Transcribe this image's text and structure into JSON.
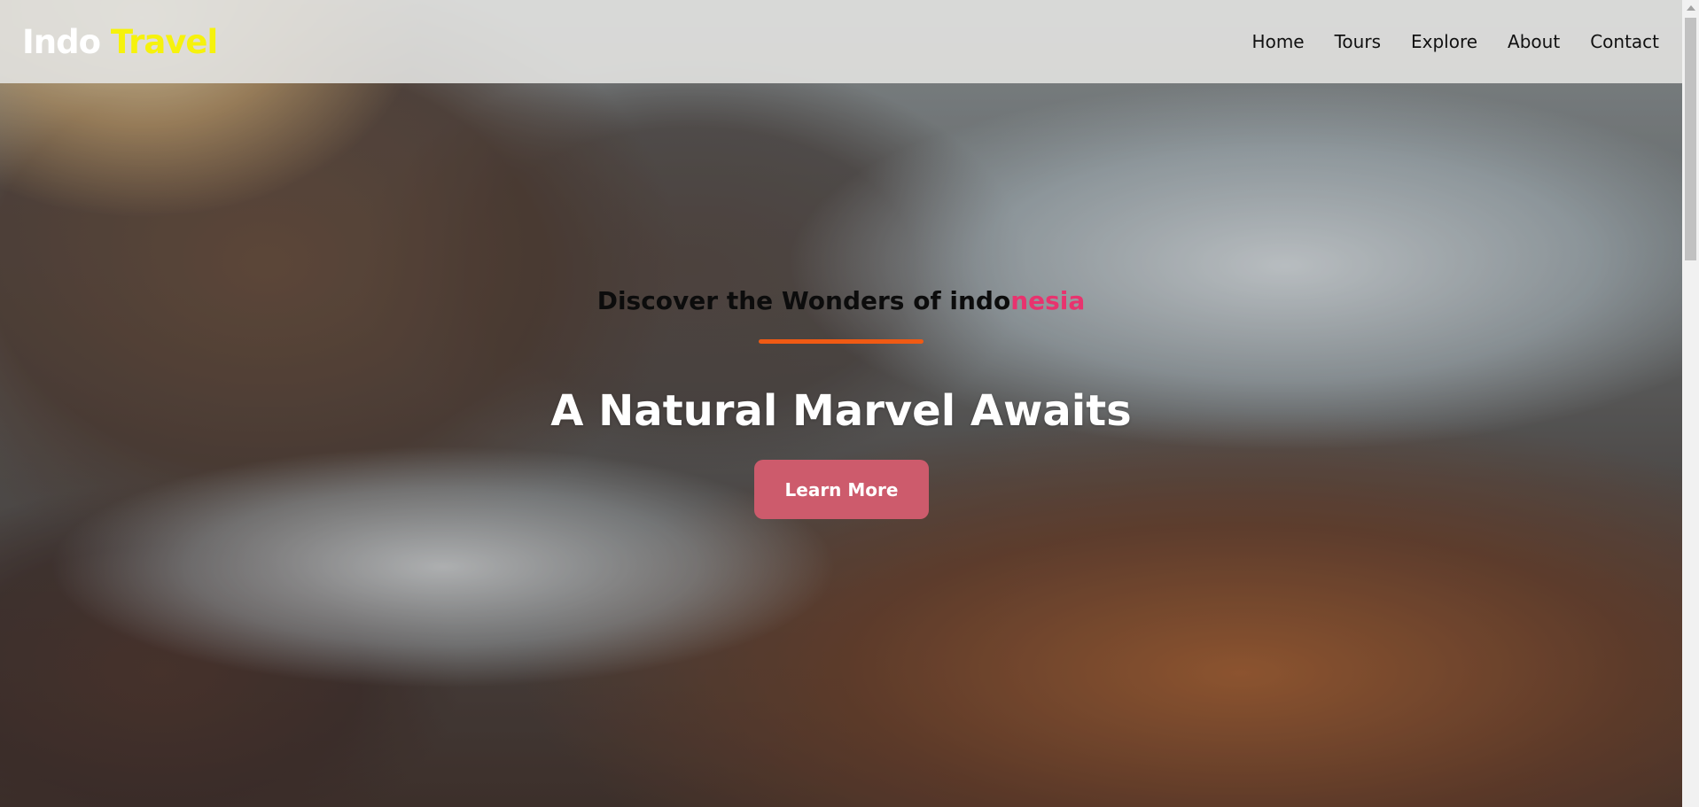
{
  "header": {
    "logo_part1": "Indo",
    "logo_part2": "Travel",
    "nav": [
      "Home",
      "Tours",
      "Explore",
      "About",
      "Contact"
    ]
  },
  "hero": {
    "subtitle_main": "Discover the Wonders of indo",
    "subtitle_accent": "nesia",
    "headline": "A Natural Marvel Awaits",
    "cta_label": "Learn More"
  },
  "colors": {
    "logo_accent": "#f6f20c",
    "subtitle_accent": "#e8336e",
    "underline": "#f05a14",
    "button": "#cd5b6c"
  },
  "icons": {
    "scroll_up": "scroll-up-arrow-icon"
  }
}
